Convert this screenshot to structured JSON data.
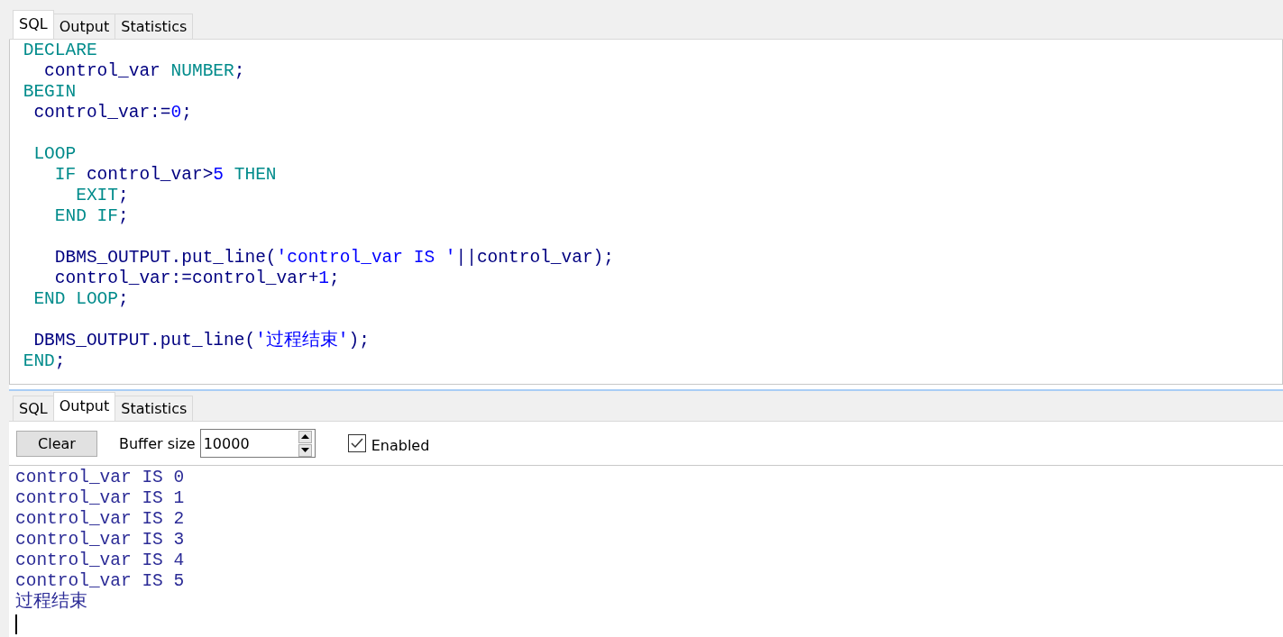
{
  "editor_tabs": [
    {
      "label": "SQL",
      "selected": true
    },
    {
      "label": "Output",
      "selected": false
    },
    {
      "label": "Statistics",
      "selected": false
    }
  ],
  "code_lines": [
    {
      "tokens": [
        {
          "kind": "keyword",
          "text": " DECLARE"
        }
      ]
    },
    {
      "tokens": [
        {
          "kind": "ident",
          "text": "   control_var"
        },
        {
          "kind": "keyword",
          "text": " NUMBER"
        },
        {
          "kind": "ident",
          "text": ";"
        }
      ]
    },
    {
      "tokens": [
        {
          "kind": "keyword",
          "text": " BEGIN"
        }
      ]
    },
    {
      "tokens": [
        {
          "kind": "ident",
          "text": "  control_var:="
        },
        {
          "kind": "number",
          "text": "0"
        },
        {
          "kind": "ident",
          "text": ";"
        }
      ]
    },
    {
      "kind": "blank"
    },
    {
      "tokens": [
        {
          "kind": "keyword",
          "text": "  LOOP"
        }
      ]
    },
    {
      "tokens": [
        {
          "kind": "keyword",
          "text": "    IF"
        },
        {
          "kind": "ident",
          "text": " control_var>"
        },
        {
          "kind": "number",
          "text": "5"
        },
        {
          "kind": "keyword",
          "text": " THEN"
        }
      ]
    },
    {
      "tokens": [
        {
          "kind": "keyword",
          "text": "      EXIT"
        },
        {
          "kind": "ident",
          "text": ";"
        }
      ]
    },
    {
      "tokens": [
        {
          "kind": "keyword",
          "text": "    END IF"
        },
        {
          "kind": "ident",
          "text": ";"
        }
      ]
    },
    {
      "kind": "blank"
    },
    {
      "tokens": [
        {
          "kind": "ident",
          "text": "    DBMS_OUTPUT.put_line("
        },
        {
          "kind": "string",
          "text": "'control_var IS '"
        },
        {
          "kind": "ident",
          "text": "||control_var);"
        }
      ]
    },
    {
      "tokens": [
        {
          "kind": "ident",
          "text": "    control_var:=control_var+"
        },
        {
          "kind": "number",
          "text": "1"
        },
        {
          "kind": "ident",
          "text": ";"
        }
      ]
    },
    {
      "tokens": [
        {
          "kind": "keyword",
          "text": "  END LOOP"
        },
        {
          "kind": "ident",
          "text": ";"
        }
      ]
    },
    {
      "kind": "blank"
    },
    {
      "tokens": [
        {
          "kind": "ident",
          "text": "  DBMS_OUTPUT.put_line("
        },
        {
          "kind": "string",
          "text": "'过程结束'"
        },
        {
          "kind": "ident",
          "text": ");"
        }
      ]
    },
    {
      "tokens": [
        {
          "kind": "keyword",
          "text": " END"
        },
        {
          "kind": "ident",
          "text": ";"
        }
      ]
    }
  ],
  "output_tabs": [
    {
      "label": "SQL",
      "selected": false
    },
    {
      "label": "Output",
      "selected": true
    },
    {
      "label": "Statistics",
      "selected": false
    }
  ],
  "clear_button": "Clear",
  "buffer_size": {
    "label": "Buffer size",
    "value": "10000"
  },
  "enabled": {
    "label": "Enabled",
    "checked": true
  },
  "output_lines": [
    "control_var IS 0",
    "control_var IS 1",
    "control_var IS 2",
    "control_var IS 3",
    "control_var IS 4",
    "control_var IS 5",
    "过程结束"
  ]
}
